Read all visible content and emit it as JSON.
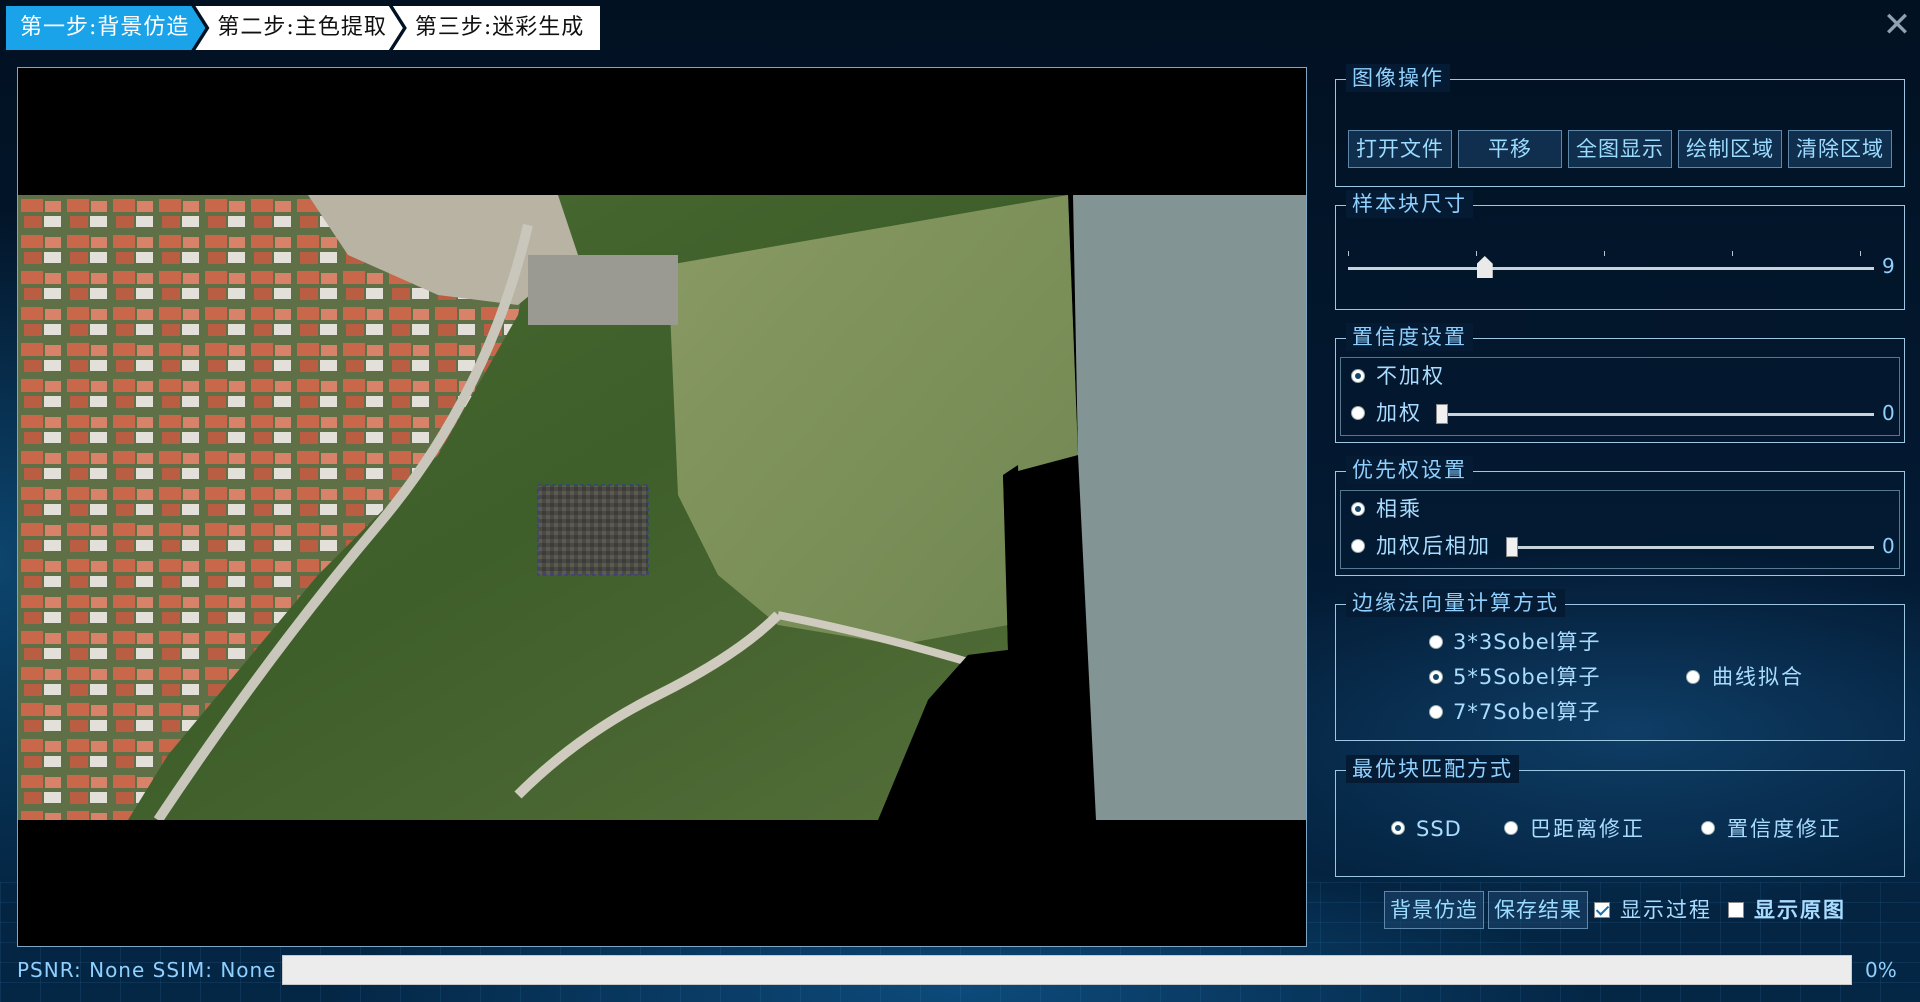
{
  "steps": [
    {
      "label": "第一步:背景仿造",
      "active": true
    },
    {
      "label": "第二步:主色提取",
      "active": false
    },
    {
      "label": "第三步:迷彩生成",
      "active": false
    }
  ],
  "close_icon": "close-icon",
  "image_ops": {
    "title": "图像操作",
    "buttons": [
      "打开文件",
      "平移",
      "全图显示",
      "绘制区域",
      "清除区域"
    ]
  },
  "sample_size": {
    "title": "样本块尺寸",
    "value": "9",
    "level_fraction": 0.26
  },
  "confidence": {
    "title": "置信度设置",
    "options": [
      "不加权",
      "加权"
    ],
    "selected": 0,
    "weight_value": "0"
  },
  "priority": {
    "title": "优先权设置",
    "options": [
      "相乘",
      "加权后相加"
    ],
    "selected": 0,
    "weight_value": "0"
  },
  "edge_normal": {
    "title": "边缘法向量计算方式",
    "options": [
      "3*3Sobel算子",
      "5*5Sobel算子",
      "7*7Sobel算子",
      "曲线拟合"
    ],
    "selected": 1
  },
  "block_match": {
    "title": "最优块匹配方式",
    "options": [
      "SSD",
      "巴距离修正",
      "置信度修正"
    ],
    "selected": 0
  },
  "actions": {
    "inpaint": "背景仿造",
    "save": "保存结果",
    "show_process": "显示过程",
    "show_process_checked": true,
    "show_original": "显示原图",
    "show_original_checked": false
  },
  "status": {
    "psnr_label": "PSNR:",
    "psnr": "None",
    "ssim_label": "SSIM:",
    "ssim": "None"
  },
  "progress": {
    "value": 0,
    "text": "0%"
  }
}
